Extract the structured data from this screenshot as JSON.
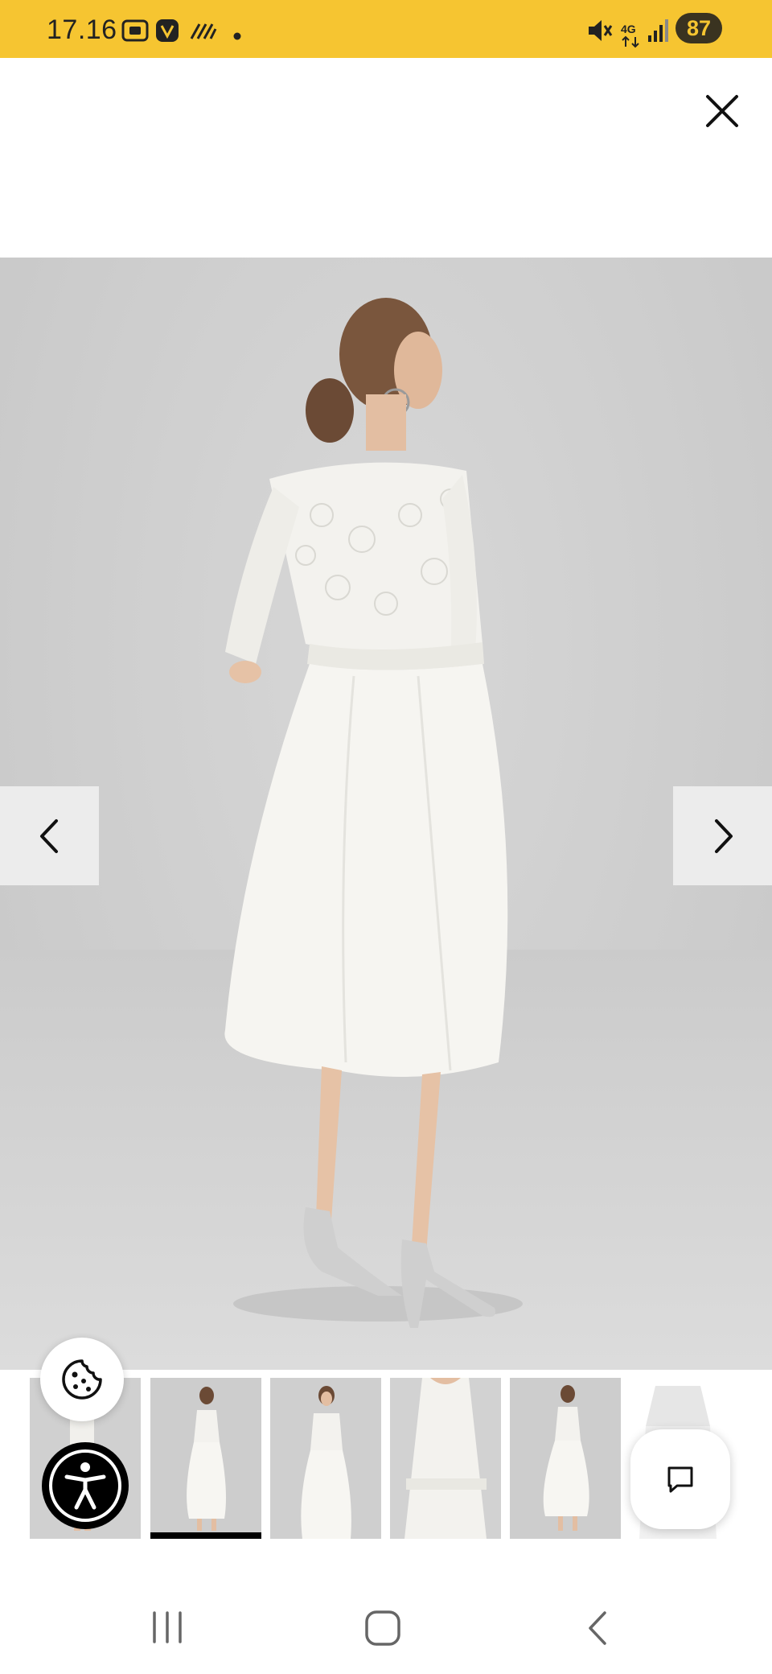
{
  "status_bar": {
    "time": "17.16",
    "battery": "87",
    "icons": [
      "screenshot-icon",
      "vpn-icon",
      "data-stripes-icon",
      "dot-icon",
      "mute-icon",
      "network-4g-icon",
      "signal-icon"
    ]
  },
  "colors": {
    "status_bar": "#f6c531",
    "accent": "#000000"
  },
  "gallery": {
    "thumbnails": [
      {
        "name": "thumb-1"
      },
      {
        "name": "thumb-2-active"
      },
      {
        "name": "thumb-3"
      },
      {
        "name": "thumb-4"
      },
      {
        "name": "thumb-5"
      },
      {
        "name": "thumb-6"
      }
    ],
    "active_index": 1
  },
  "icons": {
    "close": "close-icon",
    "prev": "chevron-left-icon",
    "next": "chevron-right-icon",
    "cookie": "cookie-icon",
    "accessibility": "accessibility-icon",
    "chat": "chat-icon",
    "recents": "recents-icon",
    "home": "home-icon",
    "back": "back-icon"
  }
}
